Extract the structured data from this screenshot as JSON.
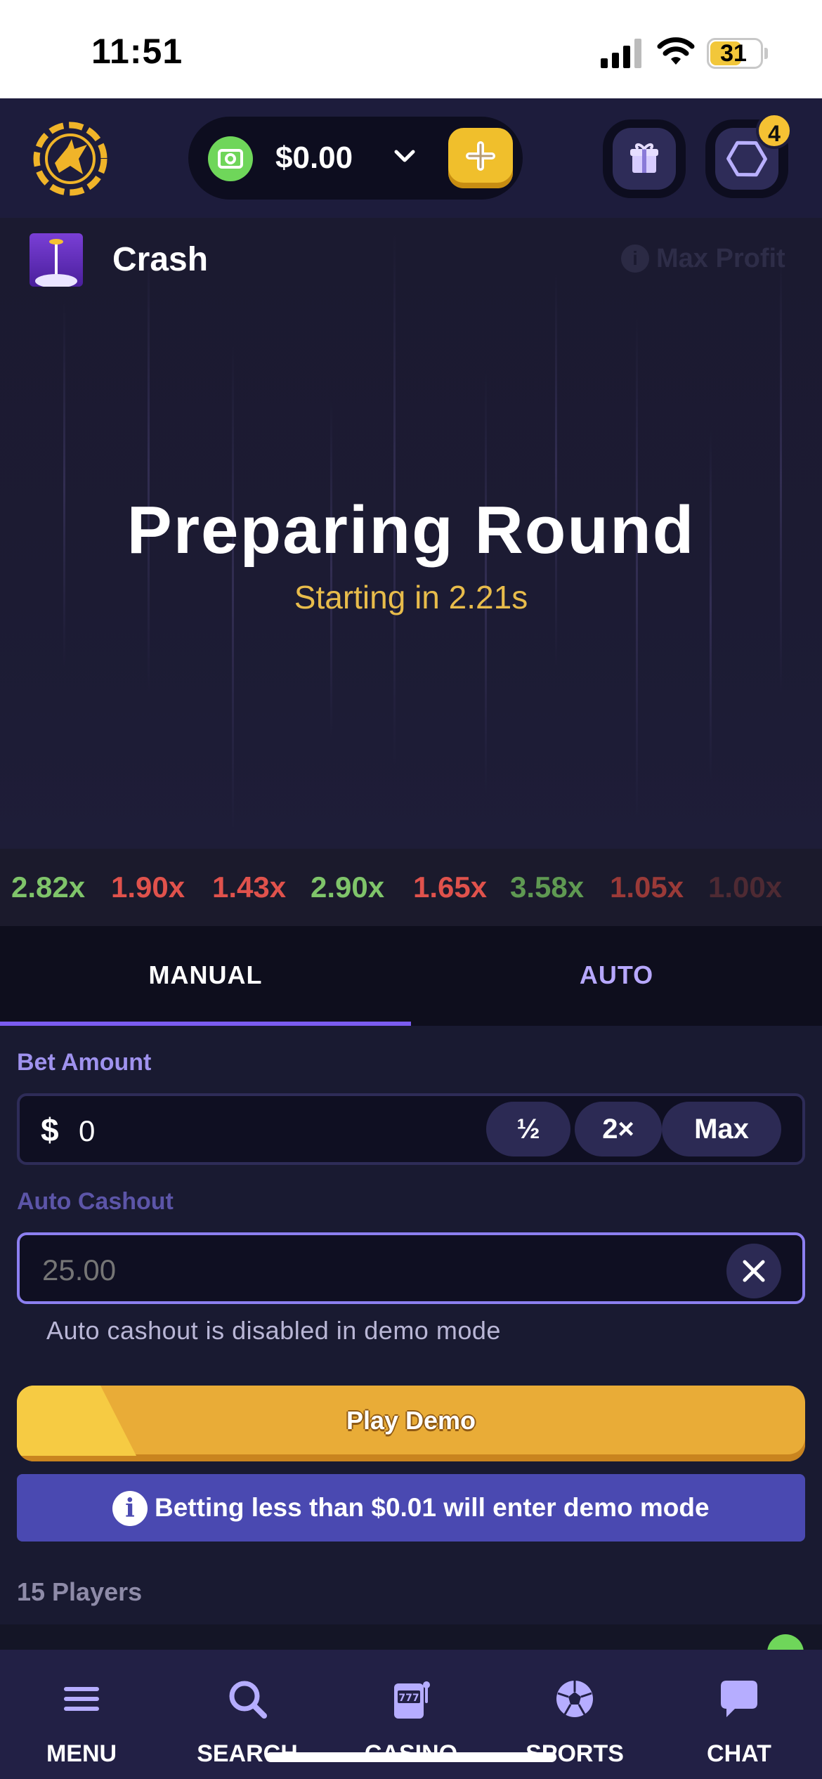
{
  "status_bar": {
    "time": "11:51",
    "battery": "31",
    "icons": [
      "signal-icon",
      "wifi-icon",
      "battery-icon"
    ]
  },
  "header": {
    "balance": "$0.00",
    "icons": [
      "logo-icon",
      "cash-icon",
      "chevron-down-icon",
      "plus-icon",
      "gift-icon",
      "hexagon-icon"
    ],
    "rewards_badge": "4"
  },
  "game": {
    "title": "Crash",
    "max_profit": "Max Profit",
    "status_title": "Preparing Round",
    "countdown": "Starting in 2.21s"
  },
  "history": [
    {
      "value": "2.82x",
      "color": "#7fc46a"
    },
    {
      "value": "1.90x",
      "color": "#e0524c"
    },
    {
      "value": "1.43x",
      "color": "#e0524c"
    },
    {
      "value": "2.90x",
      "color": "#7fc46a"
    },
    {
      "value": "1.65x",
      "color": "#e0524c"
    },
    {
      "value": "3.58x",
      "color": "#5f9952"
    },
    {
      "value": "1.05x",
      "color": "#9b3a38"
    },
    {
      "value": "1.00x",
      "color": "#4e2a33"
    }
  ],
  "tabs": [
    {
      "label": "MANUAL",
      "active": true
    },
    {
      "label": "AUTO",
      "active": false
    }
  ],
  "bet": {
    "label": "Bet Amount",
    "currency": "$",
    "value": "0",
    "half_label": "½",
    "double_label": "2×",
    "max_label": "Max"
  },
  "auto_cashout": {
    "label": "Auto Cashout",
    "placeholder": "25.00",
    "note": "Auto cashout is disabled in demo mode"
  },
  "play_button": "Play Demo",
  "demo_banner": "Betting less than $0.01 will enter demo mode",
  "players": "15 Players",
  "nav": [
    {
      "label": "MENU",
      "icon": "menu-icon"
    },
    {
      "label": "SEARCH",
      "icon": "search-icon"
    },
    {
      "label": "CASINO",
      "icon": "slot-machine-icon"
    },
    {
      "label": "SPORTS",
      "icon": "soccer-ball-icon"
    },
    {
      "label": "CHAT",
      "icon": "chat-bubble-icon"
    }
  ],
  "colors": {
    "accent_purple": "#7b5cf0",
    "gold": "#e9ac37",
    "win_green": "#7fc46a",
    "loss_red": "#e0524c"
  }
}
